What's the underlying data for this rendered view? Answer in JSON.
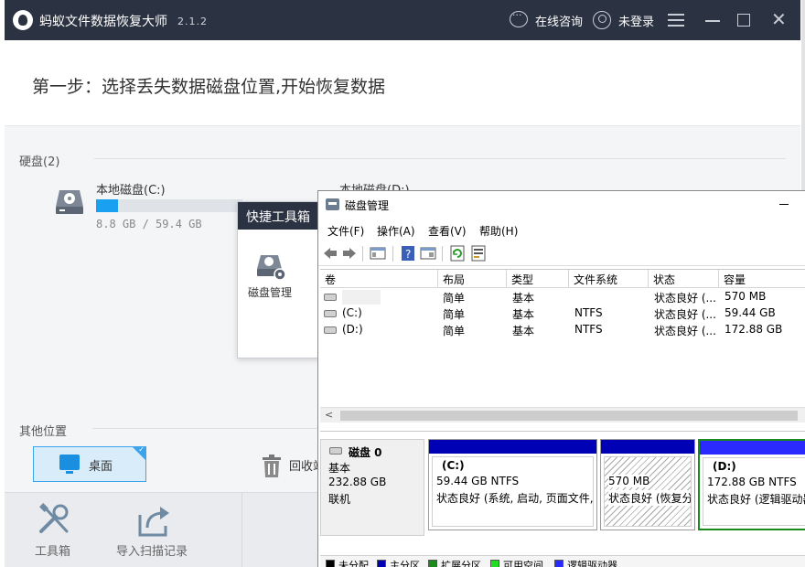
{
  "app": {
    "title": "蚂蚁文件数据恢复大师",
    "version": "2.1.2",
    "consult_label": "在线咨询",
    "login_label": "未登录",
    "step_text": "第一步：选择丢失数据磁盘位置,开始恢复数据",
    "disks_section": "硬盘(2)",
    "disks": [
      {
        "name": "本地磁盘(C:)",
        "size": "8.8 GB / 59.4 GB",
        "used_fraction": 0.148
      },
      {
        "name": "本地磁盘(D:)"
      }
    ],
    "other_section": "其他位置",
    "desktop_label": "桌面",
    "recycle_label": "回收站",
    "footer": {
      "toolbox_label": "工具箱",
      "import_label": "导入扫描记录"
    },
    "accent_color": "#1aa0f0",
    "titlebar_color": "#2b3242"
  },
  "toolbox_popup": {
    "title": "快捷工具箱",
    "item_label": "磁盘管理"
  },
  "disk_mgmt": {
    "title": "磁盘管理",
    "menus": [
      "文件(F)",
      "操作(A)",
      "查看(V)",
      "帮助(H)"
    ],
    "columns": [
      "卷",
      "布局",
      "类型",
      "文件系统",
      "状态",
      "容量"
    ],
    "rows": [
      {
        "volume": "",
        "layout": "简单",
        "type": "基本",
        "fs": "",
        "status": "状态良好 (...",
        "capacity": "570 MB"
      },
      {
        "volume": "(C:)",
        "layout": "简单",
        "type": "基本",
        "fs": "NTFS",
        "status": "状态良好 (...",
        "capacity": "59.44 GB"
      },
      {
        "volume": "(D:)",
        "layout": "简单",
        "type": "基本",
        "fs": "NTFS",
        "status": "状态良好 (...",
        "capacity": "172.88 GB"
      }
    ],
    "disk0": {
      "name": "磁盘 0",
      "type": "基本",
      "size": "232.88 GB",
      "state": "联机"
    },
    "partitions": [
      {
        "title": "(C:)",
        "line1": "59.44 GB NTFS",
        "line2": "状态良好 (系统, 启动, 页面文件,"
      },
      {
        "title": "",
        "line1": "570 MB",
        "line2": "状态良好 (恢复分"
      },
      {
        "title": "(D:)",
        "line1": "172.88 GB NTFS",
        "line2": "状态良好 (逻辑驱动器"
      }
    ],
    "legend": [
      {
        "label": "未分配",
        "color": "#000000"
      },
      {
        "label": "主分区",
        "color": "#0000b4"
      },
      {
        "label": "扩展分区",
        "color": "#1a8a1a"
      },
      {
        "label": "可用空间",
        "color": "#22dd22"
      },
      {
        "label": "逻辑驱动器",
        "color": "#2a2aff"
      }
    ]
  }
}
